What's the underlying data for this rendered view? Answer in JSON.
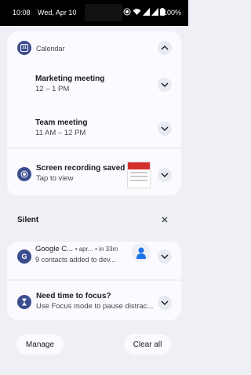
{
  "status_bar": {
    "time": "10:08",
    "date": "Wed, Apr 10",
    "battery": "100%"
  },
  "calendar": {
    "app_name": "Calendar",
    "icon_label": "31",
    "events": [
      {
        "title": "Marketing meeting",
        "time": "12 – 1 PM"
      },
      {
        "title": "Team meeting",
        "time": "11 AM – 12 PM"
      }
    ]
  },
  "screen_recording": {
    "title": "Screen recording saved",
    "subtitle": "Tap to view"
  },
  "silent": {
    "label": "Silent"
  },
  "google_contacts": {
    "app_name": "Google C...",
    "account": "• apr...",
    "eta": "• in 33m",
    "subtitle": "9 contacts added to dev..."
  },
  "focus": {
    "title": "Need time to focus?",
    "subtitle": "Use Focus mode to pause distrac..."
  },
  "actions": {
    "manage": "Manage",
    "clear_all": "Clear all"
  },
  "colors": {
    "accent": "#3b4d8f",
    "card": "#fbfbff",
    "background": "#eef0f6"
  }
}
